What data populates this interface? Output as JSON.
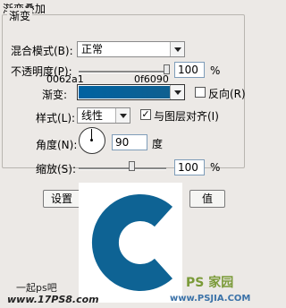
{
  "panel": {
    "title": "渐变叠加"
  },
  "section": {
    "title": "渐变"
  },
  "blend_mode": {
    "label": "混合模式(B):",
    "value": "正常"
  },
  "opacity": {
    "label": "不透明度(P):",
    "value": "100",
    "unit": "%",
    "level": 1.0
  },
  "color_codes": {
    "start": "0062a1",
    "end": "0f6090"
  },
  "gradient": {
    "label": "渐变:",
    "color_start": "#0062a1",
    "color_end": "#0f6090"
  },
  "reverse": {
    "label": "反向(R)",
    "checked": false
  },
  "style": {
    "label": "样式(L):",
    "value": "线性"
  },
  "align": {
    "label": "与图层对齐(I)",
    "checked": true
  },
  "angle": {
    "label": "角度(N):",
    "value": "90",
    "unit": "度"
  },
  "scale": {
    "label": "缩放(S):",
    "value": "100",
    "unit": "%"
  },
  "buttons": {
    "left": "设置",
    "right": "值"
  },
  "watermarks": {
    "left_top": "一起ps吧",
    "left_bottom": "www.17PS8.com",
    "right_top": "PS 家园",
    "right_bottom": "www.PSJIA.COM"
  },
  "colors": {
    "logo_blue": "#0e6394",
    "background": "#ece9e6"
  }
}
